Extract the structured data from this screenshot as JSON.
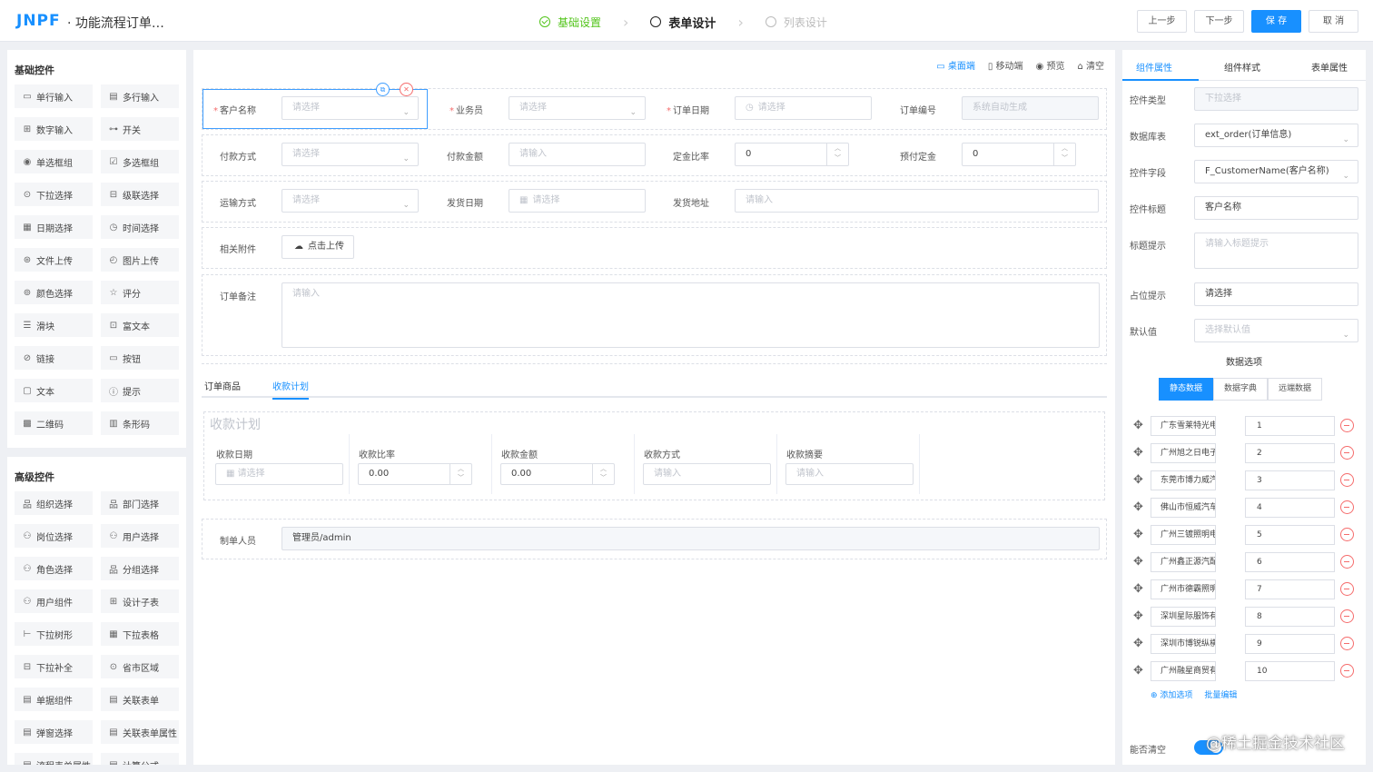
{
  "header": {
    "logo": "JNPF",
    "title": "· 功能流程订单…",
    "steps": [
      {
        "label": "基础设置",
        "state": "done"
      },
      {
        "label": "表单设计",
        "state": "active"
      },
      {
        "label": "列表设计",
        "state": "pending"
      }
    ],
    "buttons": {
      "prev": "上一步",
      "next": "下一步",
      "save": "保 存",
      "cancel": "取 消"
    }
  },
  "left": {
    "basic_title": "基础控件",
    "basic": [
      {
        "label": "单行输入",
        "icon": "▭"
      },
      {
        "label": "多行输入",
        "icon": "▤"
      },
      {
        "label": "数字输入",
        "icon": "⊞"
      },
      {
        "label": "开关",
        "icon": "⊶"
      },
      {
        "label": "单选框组",
        "icon": "◉"
      },
      {
        "label": "多选框组",
        "icon": "☑"
      },
      {
        "label": "下拉选择",
        "icon": "⊙"
      },
      {
        "label": "级联选择",
        "icon": "⊟"
      },
      {
        "label": "日期选择",
        "icon": "▦"
      },
      {
        "label": "时间选择",
        "icon": "◷"
      },
      {
        "label": "文件上传",
        "icon": "⊛"
      },
      {
        "label": "图片上传",
        "icon": "◴"
      },
      {
        "label": "颜色选择",
        "icon": "⊚"
      },
      {
        "label": "评分",
        "icon": "☆"
      },
      {
        "label": "滑块",
        "icon": "☰"
      },
      {
        "label": "富文本",
        "icon": "⊡"
      },
      {
        "label": "链接",
        "icon": "⊘"
      },
      {
        "label": "按钮",
        "icon": "▭"
      },
      {
        "label": "文本",
        "icon": "▢"
      },
      {
        "label": "提示",
        "icon": "ⓘ"
      },
      {
        "label": "二维码",
        "icon": "▩"
      },
      {
        "label": "条形码",
        "icon": "▥"
      }
    ],
    "adv_title": "高级控件",
    "advanced": [
      {
        "label": "组织选择",
        "icon": "品"
      },
      {
        "label": "部门选择",
        "icon": "品"
      },
      {
        "label": "岗位选择",
        "icon": "⚇"
      },
      {
        "label": "用户选择",
        "icon": "⚇"
      },
      {
        "label": "角色选择",
        "icon": "⚇"
      },
      {
        "label": "分组选择",
        "icon": "品"
      },
      {
        "label": "用户组件",
        "icon": "⚇"
      },
      {
        "label": "设计子表",
        "icon": "⊞"
      },
      {
        "label": "下拉树形",
        "icon": "⊢"
      },
      {
        "label": "下拉表格",
        "icon": "▦"
      },
      {
        "label": "下拉补全",
        "icon": "⊟"
      },
      {
        "label": "省市区域",
        "icon": "⊙"
      },
      {
        "label": "单据组件",
        "icon": "▤"
      },
      {
        "label": "关联表单",
        "icon": "▤"
      },
      {
        "label": "弹窗选择",
        "icon": "▤"
      },
      {
        "label": "关联表单属性",
        "icon": "▤"
      },
      {
        "label": "流程表单属性",
        "icon": "▤"
      },
      {
        "label": "计算公式",
        "icon": "▤"
      }
    ]
  },
  "center": {
    "toolbar": [
      {
        "label": "桌面端",
        "icon": "▭",
        "on": true
      },
      {
        "label": "移动端",
        "icon": "▯",
        "on": false
      },
      {
        "label": "预览",
        "icon": "◉",
        "on": false
      },
      {
        "label": "清空",
        "icon": "⌂",
        "on": false
      }
    ],
    "fields": {
      "customer": {
        "label": "客户名称",
        "placeholder": "请选择"
      },
      "salesman": {
        "label": "业务员",
        "placeholder": "请选择"
      },
      "order_date": {
        "label": "订单日期",
        "placeholder": "请选择"
      },
      "order_no": {
        "label": "订单编号",
        "placeholder": "系统自动生成"
      },
      "pay_method": {
        "label": "付款方式",
        "placeholder": "请选择"
      },
      "pay_amount": {
        "label": "付款金额",
        "placeholder": "请输入"
      },
      "deposit_rate": {
        "label": "定金比率",
        "value": "0"
      },
      "prepay": {
        "label": "预付定金",
        "value": "0"
      },
      "shipping": {
        "label": "运输方式",
        "placeholder": "请选择"
      },
      "ship_date": {
        "label": "发货日期",
        "placeholder": "请选择"
      },
      "ship_addr": {
        "label": "发货地址",
        "placeholder": "请输入"
      },
      "attach": {
        "label": "相关附件",
        "button": "点击上传"
      },
      "remark": {
        "label": "订单备注",
        "placeholder": "请输入"
      },
      "maker": {
        "label": "制单人员",
        "value": "管理员/admin"
      }
    },
    "tabs": [
      "订单商品",
      "收款计划"
    ],
    "sub": {
      "title": "收款计划",
      "cols": [
        {
          "label": "收款日期",
          "ph": "请选择",
          "kind": "date"
        },
        {
          "label": "收款比率",
          "val": "0.00",
          "kind": "num"
        },
        {
          "label": "收款金额",
          "val": "0.00",
          "kind": "num"
        },
        {
          "label": "收款方式",
          "ph": "请输入",
          "kind": "text"
        },
        {
          "label": "收款摘要",
          "ph": "请输入",
          "kind": "text"
        }
      ]
    }
  },
  "right": {
    "tabs": [
      "组件属性",
      "组件样式",
      "表单属性"
    ],
    "props": [
      {
        "label": "控件类型",
        "value": "下拉选择",
        "kind": "disabled"
      },
      {
        "label": "数据库表",
        "value": "ext_order(订单信息)",
        "kind": "select"
      },
      {
        "label": "控件字段",
        "value": "F_CustomerName(客户名称)",
        "kind": "select"
      },
      {
        "label": "控件标题",
        "value": "客户名称",
        "kind": "text"
      },
      {
        "label": "标题提示",
        "placeholder": "请输入标题提示",
        "kind": "textarea"
      },
      {
        "label": "占位提示",
        "value": "请选择",
        "kind": "text"
      },
      {
        "label": "默认值",
        "placeholder": "选择默认值",
        "kind": "select-ph"
      }
    ],
    "data_title": "数据选项",
    "data_types": [
      "静态数据",
      "数据字典",
      "远端数据"
    ],
    "options": [
      {
        "name": "广东雪莱特光电科",
        "value": "1"
      },
      {
        "name": "广州旭之日电子科",
        "value": "2"
      },
      {
        "name": "东莞市博力威汽车",
        "value": "3"
      },
      {
        "name": "佛山市恒威汽车维",
        "value": "4"
      },
      {
        "name": "广州三镀照明电器",
        "value": "5"
      },
      {
        "name": "广州鑫正源汽配有",
        "value": "6"
      },
      {
        "name": "广州市德霸照明电",
        "value": "7"
      },
      {
        "name": "深圳星际服饰有限",
        "value": "8"
      },
      {
        "name": "深圳市博锐纵横科",
        "value": "9"
      },
      {
        "name": "广州融星商贸有限",
        "value": "10"
      }
    ],
    "add_option": "添加选项",
    "batch_edit": "批量编辑",
    "clearable_label": "能否清空"
  },
  "watermark": "@稀土掘金技术社区",
  "colors": {
    "accent": "#1890ff",
    "done": "#52c41a",
    "danger": "#f56c6c"
  }
}
